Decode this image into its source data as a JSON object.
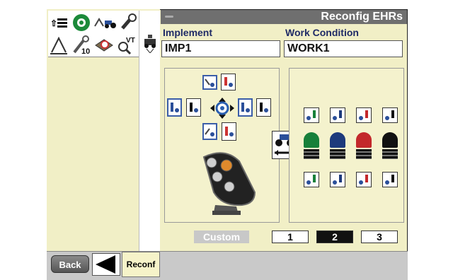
{
  "header": {
    "title": "Reconfig EHRs"
  },
  "implement": {
    "label": "Implement",
    "value": "IMP1"
  },
  "work_condition": {
    "label": "Work Condition",
    "value": "WORK1"
  },
  "toolbar_icons": [
    "sort-list-icon",
    "green-gear-icon",
    "tractor-implement-icon",
    "wrench-chain-icon",
    "up-arrow-icon",
    "tractor-hitch-icon",
    "wrench-10-icon",
    "book-clock-icon",
    "vt-search-icon"
  ],
  "vt_label": "VT",
  "wrench_number": "10",
  "pattern": {
    "custom_label": "Custom",
    "buttons": [
      "1",
      "2",
      "3"
    ],
    "selected": "2"
  },
  "levers": [
    {
      "color": "#17803a"
    },
    {
      "color": "#1d3a7c"
    },
    {
      "color": "#c3282b"
    },
    {
      "color": "#111111"
    }
  ],
  "footer": {
    "back_label": "Back",
    "tab_label": "Reconf"
  }
}
